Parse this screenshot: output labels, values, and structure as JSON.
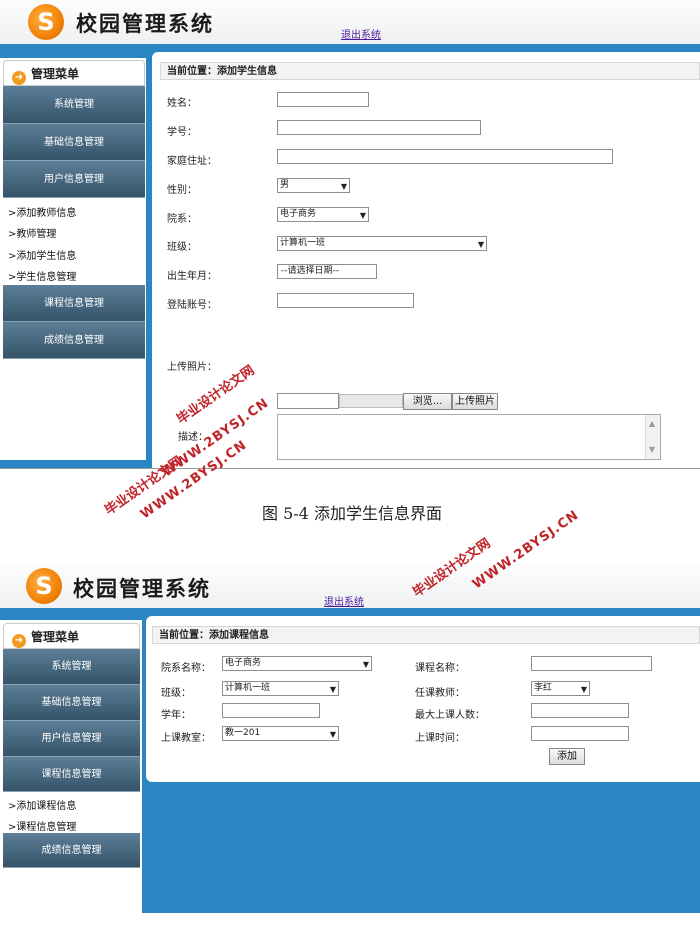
{
  "app": {
    "title": "校园管理系统",
    "logout": "退出系统",
    "logo_letter": "S"
  },
  "sidebar": {
    "header": "管理菜单"
  },
  "screen1": {
    "menu": [
      "系统管理",
      "基础信息管理",
      "用户信息管理"
    ],
    "sub_items": [
      ">添加教师信息",
      ">教师管理",
      ">添加学生信息",
      ">学生信息管理"
    ],
    "menu_after": [
      "课程信息管理",
      "成绩信息管理"
    ],
    "location": "当前位置：添加学生信息",
    "fields": {
      "name": "姓名：",
      "student_id": "学号：",
      "address": "家庭住址：",
      "gender": "性别：",
      "department": "院系：",
      "class": "班级：",
      "birth": "出生年月：",
      "account": "登陆账号：",
      "photo": "上传照片：",
      "description": "描述："
    },
    "values": {
      "gender": "男",
      "department": "电子商务",
      "class": "计算机一班",
      "birth": "--请选择日期--"
    },
    "buttons": {
      "browse": "浏览...",
      "upload": "上传照片"
    }
  },
  "caption": "图 5-4 添加学生信息界面",
  "screen2": {
    "menu": [
      "系统管理",
      "基础信息管理",
      "用户信息管理",
      "课程信息管理"
    ],
    "sub_items": [
      ">添加课程信息",
      ">课程信息管理"
    ],
    "menu_after": [
      "成绩信息管理"
    ],
    "location": "当前位置：添加课程信息",
    "fields": {
      "department": "院系名称：",
      "course_name": "课程名称：",
      "class": "班级：",
      "teacher": "任课教师：",
      "year": "学年：",
      "max_students": "最大上课人数：",
      "classroom": "上课教室：",
      "time": "上课时间："
    },
    "values": {
      "department": "电子商务",
      "class": "计算机一班",
      "teacher": "李红",
      "classroom": "教一201"
    },
    "buttons": {
      "add": "添加"
    }
  },
  "watermark": {
    "cn": "毕业设计论文网",
    "url": "WWW.2BYSJ.CN"
  },
  "colors": {
    "blue_bg": "#2a86c3",
    "menu_btn": "#466a82",
    "accent": "#f07c00",
    "watermark": "#c0242a"
  }
}
